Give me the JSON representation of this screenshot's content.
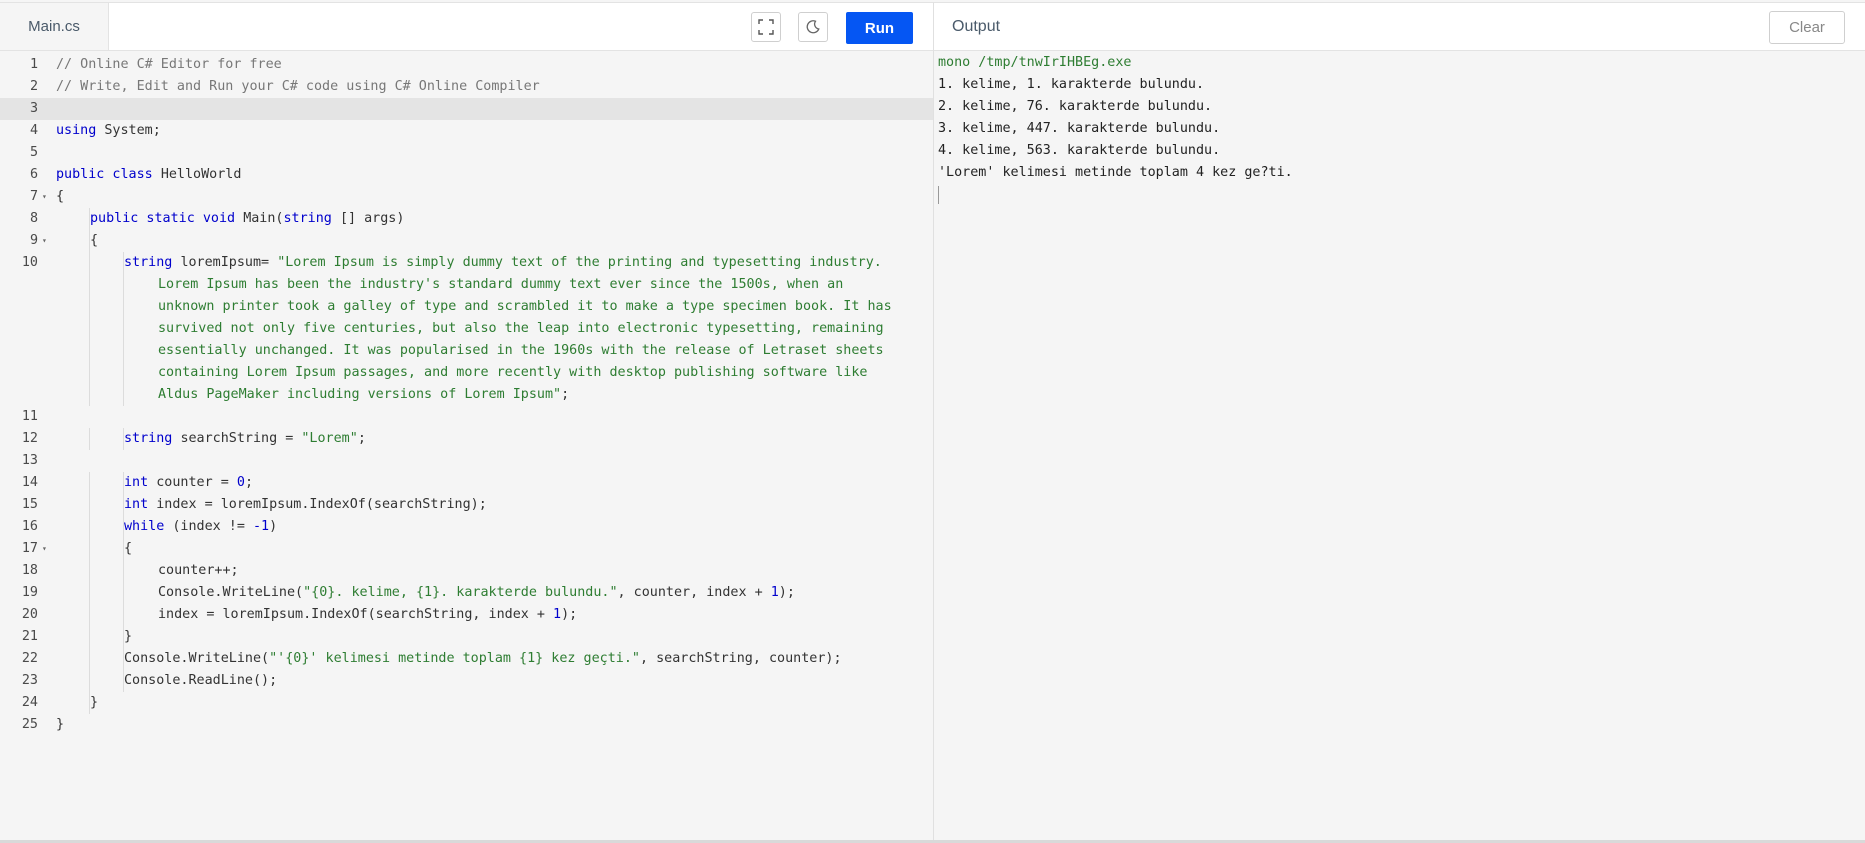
{
  "editor": {
    "file_tab": "Main.cs",
    "run_label": "Run",
    "fullscreen_icon": "fullscreen-icon",
    "theme_icon": "moon-icon",
    "active_line": 3,
    "lines": [
      {
        "n": "1",
        "fold": false,
        "indent": 0,
        "segs": [
          [
            "cm",
            "// Online C# Editor for free"
          ]
        ]
      },
      {
        "n": "2",
        "fold": false,
        "indent": 0,
        "segs": [
          [
            "cm",
            "// Write, Edit and Run your C# code using C# Online Compiler"
          ]
        ]
      },
      {
        "n": "3",
        "fold": false,
        "indent": 0,
        "segs": []
      },
      {
        "n": "4",
        "fold": false,
        "indent": 0,
        "segs": [
          [
            "kw",
            "using"
          ],
          [
            "",
            "System;"
          ]
        ]
      },
      {
        "n": "5",
        "fold": false,
        "indent": 0,
        "segs": []
      },
      {
        "n": "6",
        "fold": false,
        "indent": 0,
        "segs": [
          [
            "kw",
            "public class"
          ],
          [
            "",
            "HelloWorld"
          ]
        ]
      },
      {
        "n": "7",
        "fold": true,
        "indent": 0,
        "segs": [
          [
            "",
            "{"
          ]
        ]
      },
      {
        "n": "8",
        "fold": false,
        "indent": 1,
        "segs": [
          [
            "kw",
            "public static void"
          ],
          [
            "",
            "Main("
          ],
          [
            "kw",
            "string"
          ],
          [
            "",
            "[] args)"
          ]
        ]
      },
      {
        "n": "9",
        "fold": true,
        "indent": 1,
        "segs": [
          [
            "",
            "{"
          ]
        ]
      },
      {
        "n": "10",
        "fold": false,
        "indent": 2,
        "segs": [
          [
            "kw",
            "string"
          ],
          [
            "",
            "loremIpsum= "
          ],
          [
            "str",
            "\"Lorem Ipsum is simply dummy text of the printing and typesetting industry."
          ]
        ]
      },
      {
        "n": "",
        "fold": false,
        "indent": 3,
        "segs": [
          [
            "str",
            "Lorem Ipsum has been the industry's standard dummy text ever since the 1500s, when an"
          ]
        ]
      },
      {
        "n": "",
        "fold": false,
        "indent": 3,
        "segs": [
          [
            "str",
            "unknown printer took a galley of type and scrambled it to make a type specimen book. It has"
          ]
        ]
      },
      {
        "n": "",
        "fold": false,
        "indent": 3,
        "segs": [
          [
            "str",
            "survived not only five centuries, but also the leap into electronic typesetting, remaining"
          ]
        ]
      },
      {
        "n": "",
        "fold": false,
        "indent": 3,
        "segs": [
          [
            "str",
            "essentially unchanged. It was popularised in the 1960s with the release of Letraset sheets"
          ]
        ]
      },
      {
        "n": "",
        "fold": false,
        "indent": 3,
        "segs": [
          [
            "str",
            "containing Lorem Ipsum passages, and more recently with desktop publishing software like"
          ]
        ]
      },
      {
        "n": "",
        "fold": false,
        "indent": 3,
        "segs": [
          [
            "str",
            "Aldus PageMaker including versions of Lorem Ipsum\""
          ],
          [
            "",
            ";"
          ]
        ]
      },
      {
        "n": "11",
        "fold": false,
        "indent": 0,
        "segs": []
      },
      {
        "n": "12",
        "fold": false,
        "indent": 2,
        "segs": [
          [
            "kw",
            "string"
          ],
          [
            "",
            "searchString = "
          ],
          [
            "str",
            "\"Lorem\""
          ],
          [
            "",
            ";"
          ]
        ]
      },
      {
        "n": "13",
        "fold": false,
        "indent": 0,
        "segs": []
      },
      {
        "n": "14",
        "fold": false,
        "indent": 2,
        "segs": [
          [
            "kw",
            "int"
          ],
          [
            "",
            "counter = "
          ],
          [
            "num",
            "0"
          ],
          [
            "",
            ";"
          ]
        ]
      },
      {
        "n": "15",
        "fold": false,
        "indent": 2,
        "segs": [
          [
            "kw",
            "int"
          ],
          [
            "",
            "index = loremIpsum.IndexOf(searchString);"
          ]
        ]
      },
      {
        "n": "16",
        "fold": false,
        "indent": 2,
        "segs": [
          [
            "kw",
            "while"
          ],
          [
            "",
            "(index != "
          ],
          [
            "num",
            "-1"
          ],
          [
            "",
            ")"
          ]
        ]
      },
      {
        "n": "17",
        "fold": true,
        "indent": 2,
        "segs": [
          [
            "",
            "{"
          ]
        ]
      },
      {
        "n": "18",
        "fold": false,
        "indent": 3,
        "segs": [
          [
            "",
            "counter++;"
          ]
        ]
      },
      {
        "n": "19",
        "fold": false,
        "indent": 3,
        "segs": [
          [
            "",
            "Console.WriteLine("
          ],
          [
            "str",
            "\"{0}. kelime, {1}. karakterde bulundu.\""
          ],
          [
            "",
            ", counter, index + "
          ],
          [
            "num",
            "1"
          ],
          [
            "",
            ");"
          ]
        ]
      },
      {
        "n": "20",
        "fold": false,
        "indent": 3,
        "segs": [
          [
            "",
            "index = loremIpsum.IndexOf(searchString, index + "
          ],
          [
            "num",
            "1"
          ],
          [
            "",
            ");"
          ]
        ]
      },
      {
        "n": "21",
        "fold": false,
        "indent": 2,
        "segs": [
          [
            "",
            "}"
          ]
        ]
      },
      {
        "n": "22",
        "fold": false,
        "indent": 2,
        "segs": [
          [
            "",
            "Console.WriteLine("
          ],
          [
            "str",
            "\"'{0}' kelimesi metinde toplam {1} kez geçti.\""
          ],
          [
            "",
            ", searchString, counter);"
          ]
        ]
      },
      {
        "n": "23",
        "fold": false,
        "indent": 2,
        "segs": [
          [
            "",
            "Console.ReadLine();"
          ]
        ]
      },
      {
        "n": "24",
        "fold": false,
        "indent": 1,
        "segs": [
          [
            "",
            "}"
          ]
        ]
      },
      {
        "n": "25",
        "fold": false,
        "indent": 0,
        "segs": [
          [
            "",
            "}"
          ]
        ]
      }
    ]
  },
  "output": {
    "title": "Output",
    "clear_label": "Clear",
    "command": "mono /tmp/tnwIrIHBEg.exe",
    "lines": [
      "1. kelime, 1. karakterde bulundu.",
      "2. kelime, 76. karakterde bulundu.",
      "3. kelime, 447. karakterde bulundu.",
      "4. kelime, 563. karakterde bulundu.",
      "'Lorem' kelimesi metinde toplam 4 kez ge?ti."
    ]
  }
}
